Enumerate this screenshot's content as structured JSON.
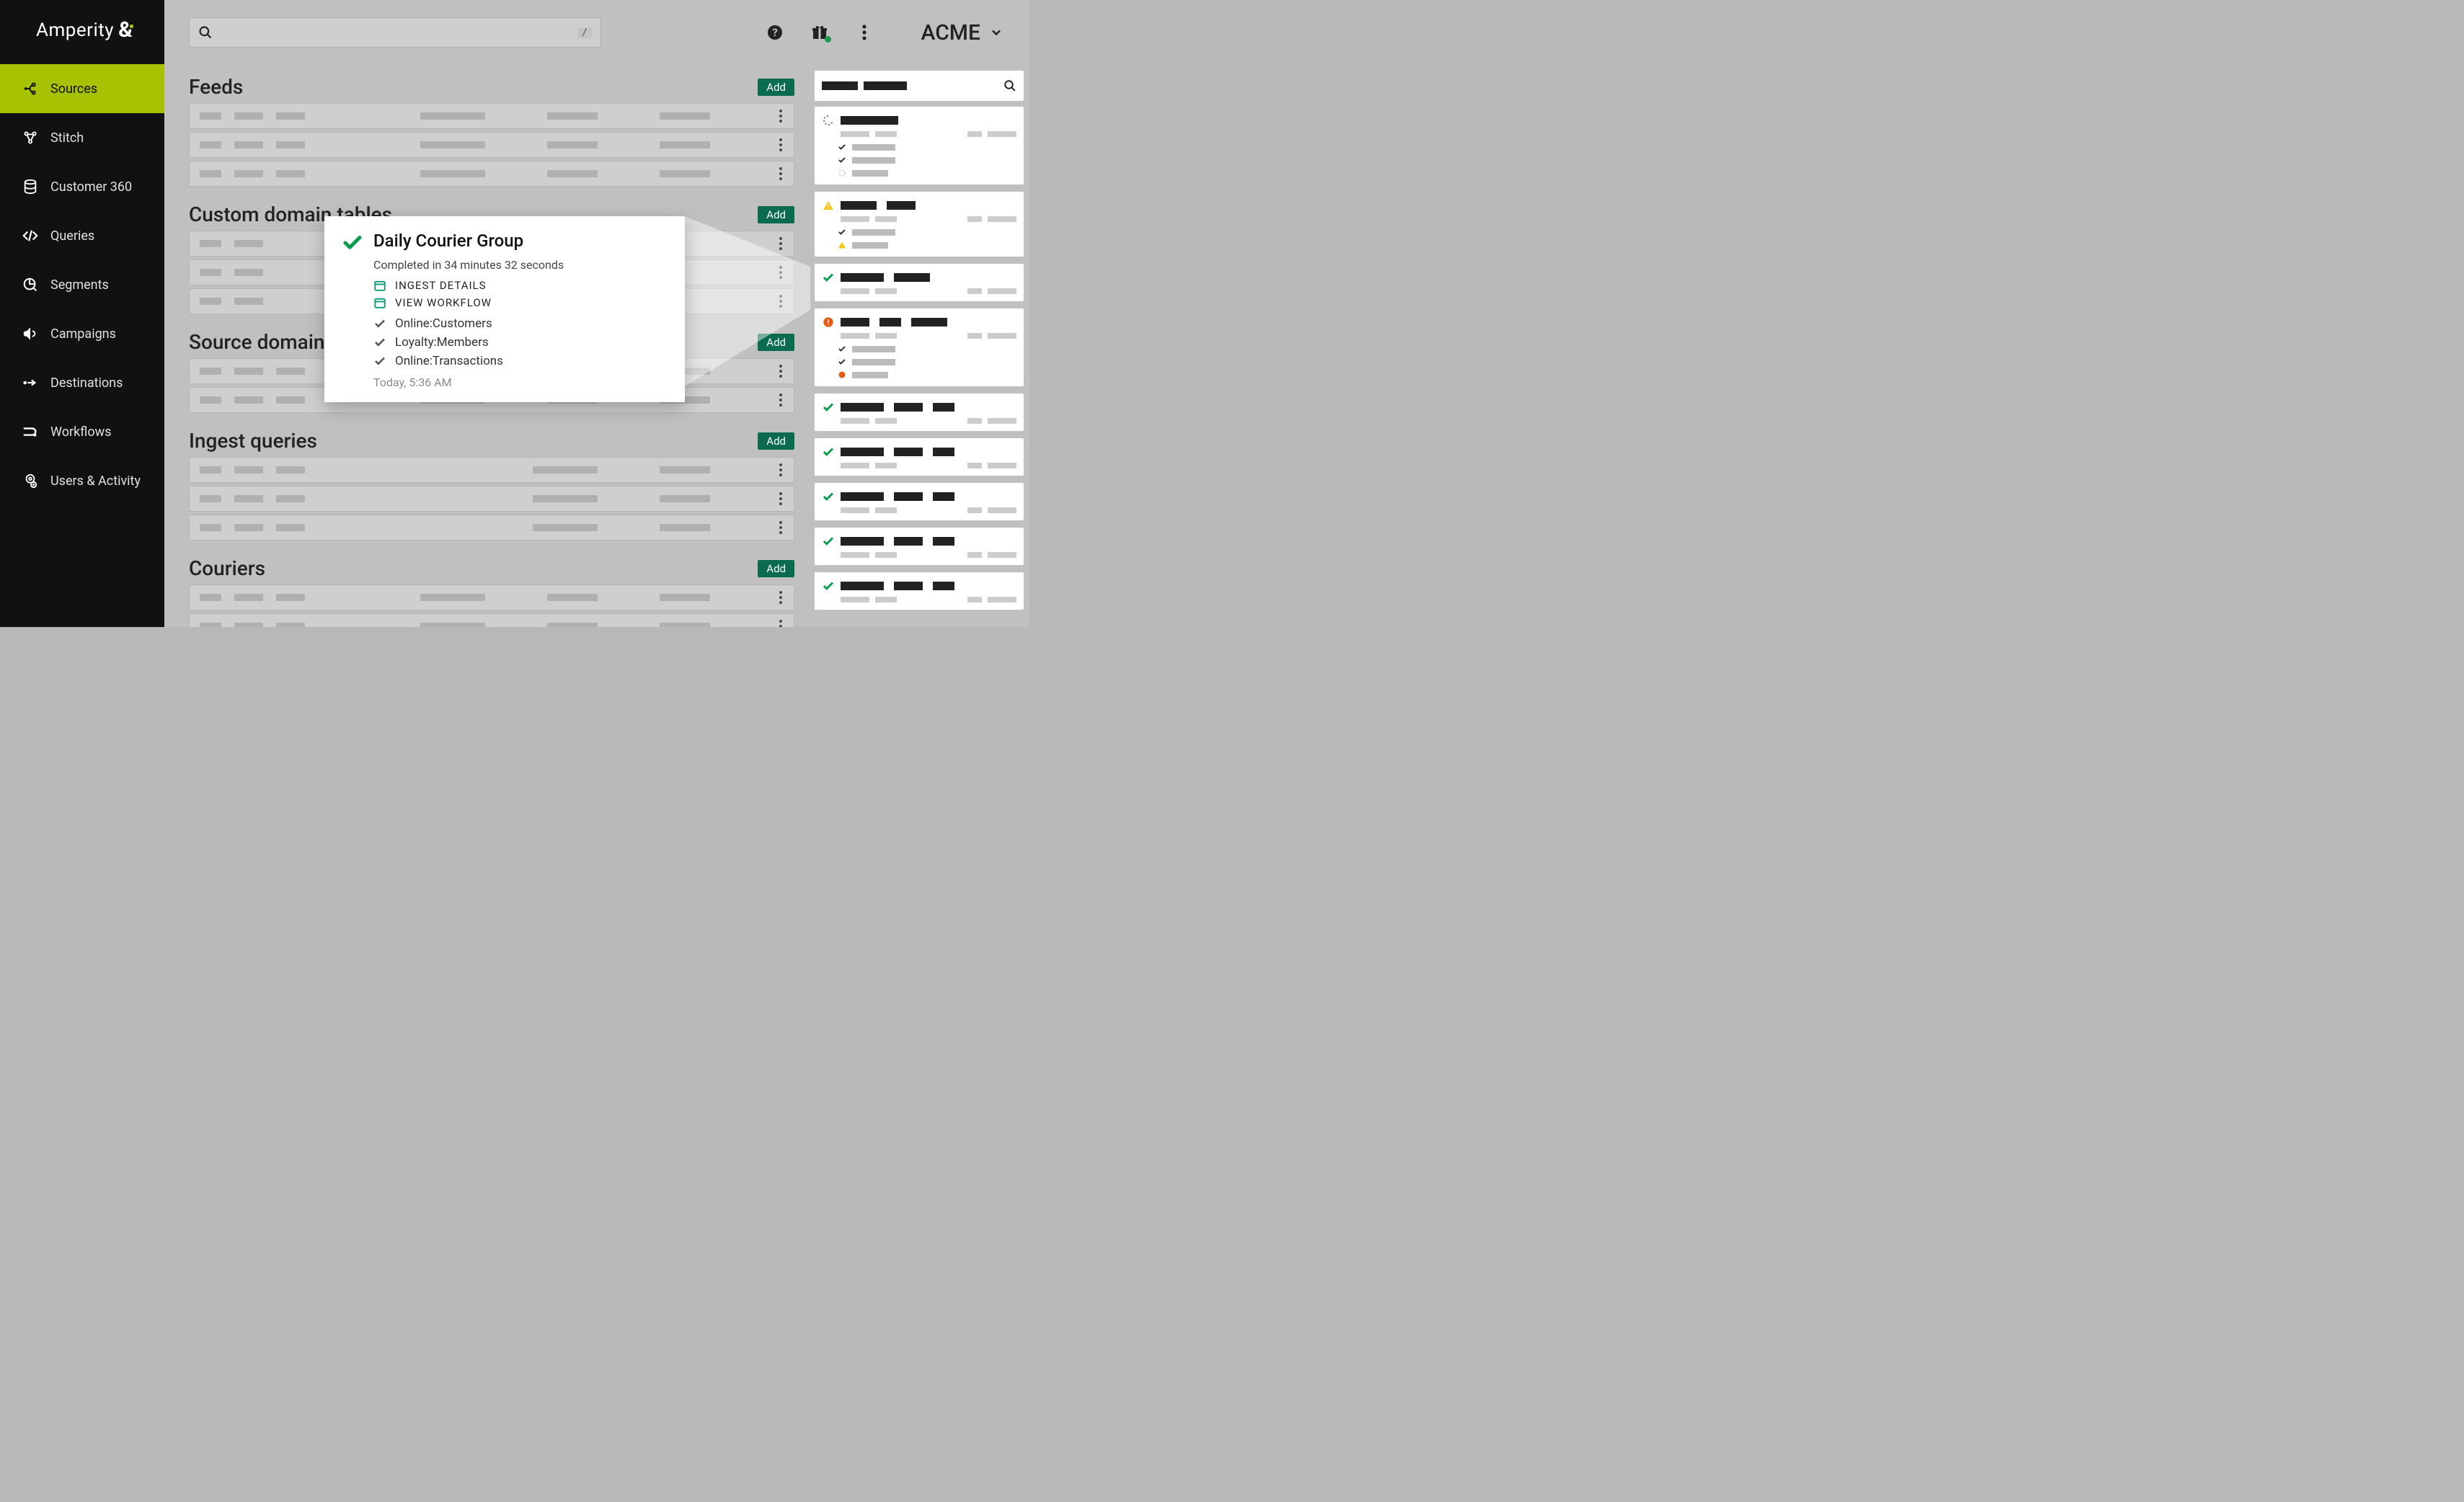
{
  "brand": "Amperity",
  "tenant": "ACME",
  "search": {
    "placeholder": "",
    "shortcut": "/"
  },
  "sidebar": {
    "items": [
      {
        "label": "Sources"
      },
      {
        "label": "Stitch"
      },
      {
        "label": "Customer 360"
      },
      {
        "label": "Queries"
      },
      {
        "label": "Segments"
      },
      {
        "label": "Campaigns"
      },
      {
        "label": "Destinations"
      },
      {
        "label": "Workflows"
      },
      {
        "label": "Users & Activity"
      }
    ]
  },
  "sections": [
    {
      "title": "Feeds",
      "add": "Add"
    },
    {
      "title": "Custom domain tables",
      "add": "Add"
    },
    {
      "title": "Source domain tables",
      "add": "Add"
    },
    {
      "title": "Ingest queries",
      "add": "Add"
    },
    {
      "title": "Couriers",
      "add": "Add"
    }
  ],
  "popup": {
    "title": "Daily Courier Group",
    "subtitle": "Completed in 34 minutes 32 seconds",
    "links": [
      {
        "label": "INGEST DETAILS"
      },
      {
        "label": "VIEW WORKFLOW"
      }
    ],
    "items": [
      "Online:Customers",
      "Loyalty:Members",
      "Online:Transactions"
    ],
    "timestamp": "Today, 5:36 AM"
  }
}
